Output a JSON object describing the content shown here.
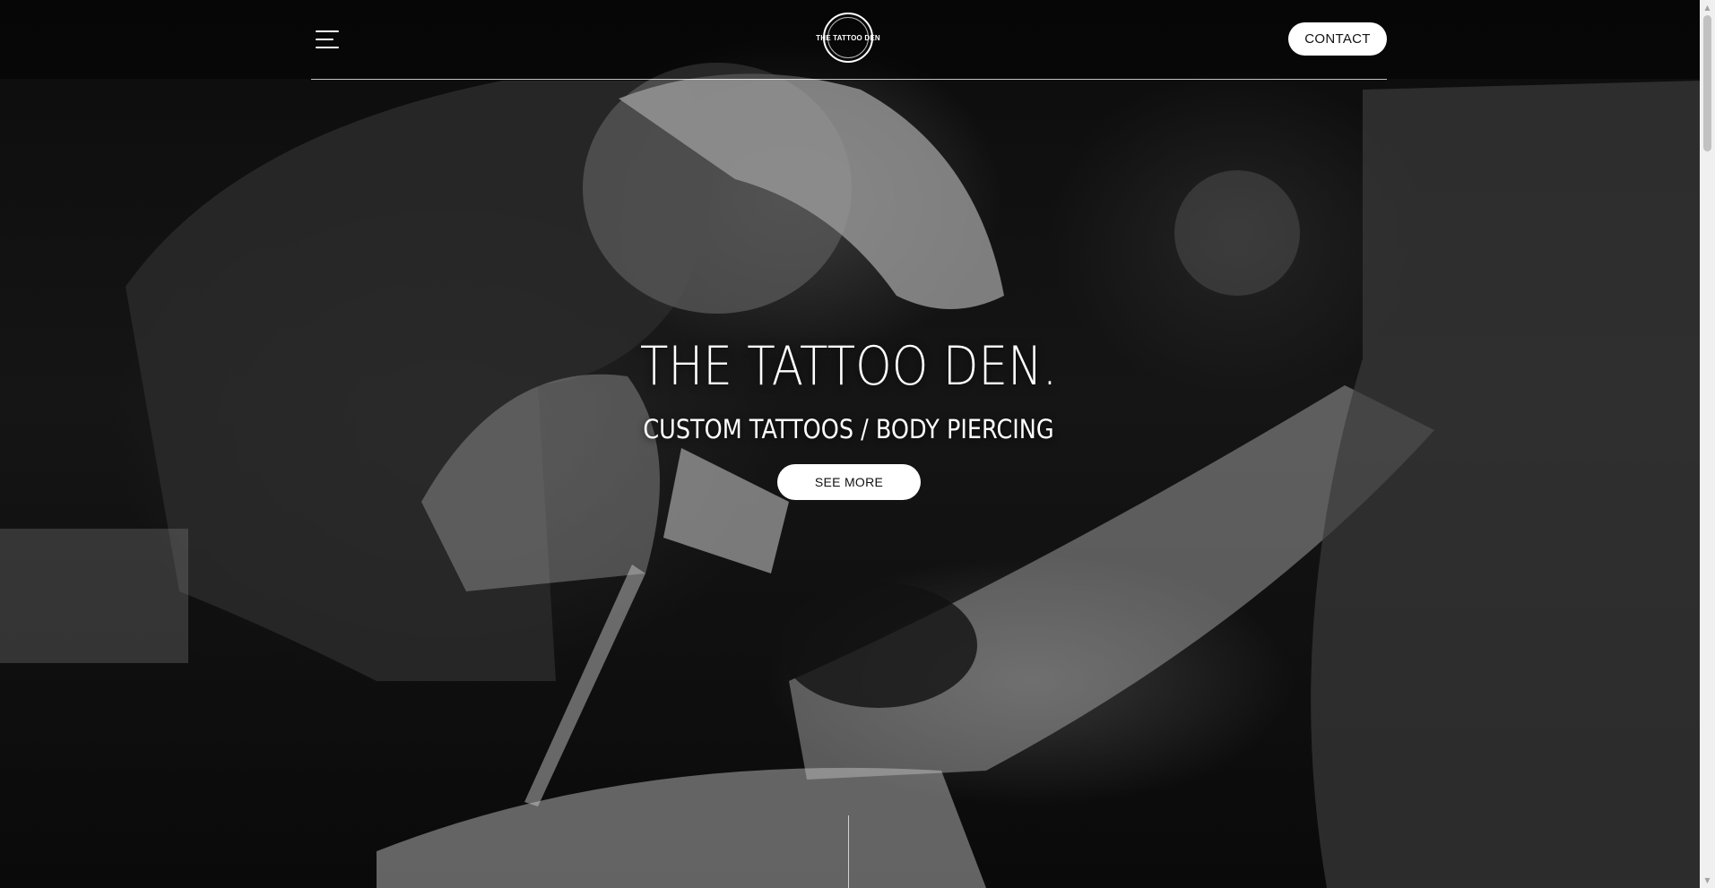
{
  "header": {
    "logo_text": "THE TATTOO DEN",
    "contact_label": "CONTACT"
  },
  "hero": {
    "title": "THE TATTOO DEN.",
    "subtitle": "CUSTOM TATTOOS / BODY PIERCING",
    "cta_label": "SEE MORE"
  },
  "icons": {
    "menu": "hamburger-menu-icon",
    "scroll_up": "arrow-up-icon",
    "scroll_down": "arrow-down-icon"
  },
  "scrollbar": {
    "position_fraction": 0.0
  },
  "colors": {
    "background": "#050505",
    "text": "#ffffff",
    "button_bg": "#ffffff",
    "button_text": "#111111"
  }
}
